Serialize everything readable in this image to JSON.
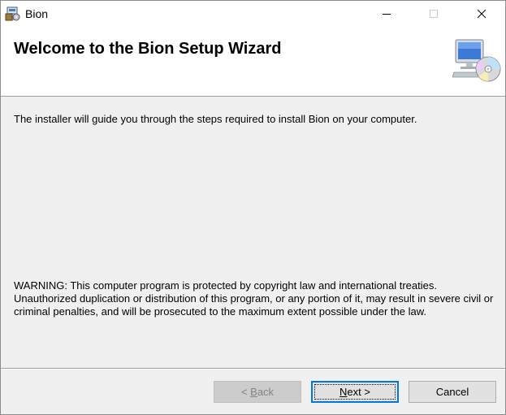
{
  "window": {
    "title": "Bion"
  },
  "header": {
    "title": "Welcome to the Bion Setup Wizard",
    "graphic_icon": "computer-with-cd-icon"
  },
  "body": {
    "intro": "The installer will guide you through the steps required to install Bion on your computer.",
    "warning": "WARNING: This computer program is protected by copyright law and international treaties. Unauthorized duplication or distribution of this program, or any portion of it, may result in severe civil or criminal penalties, and will be prosecuted to the maximum extent possible under the law."
  },
  "buttons": {
    "back": {
      "prefix": "< ",
      "mnemonic": "B",
      "rest": "ack",
      "enabled": false
    },
    "next": {
      "mnemonic": "N",
      "rest": "ext",
      "suffix": " >",
      "focused": true
    },
    "cancel": {
      "label": "Cancel"
    }
  },
  "colors": {
    "accent": "#0078d7",
    "window_bg": "#f0f0f0",
    "header_bg": "#ffffff",
    "disabled_text": "#838383"
  }
}
